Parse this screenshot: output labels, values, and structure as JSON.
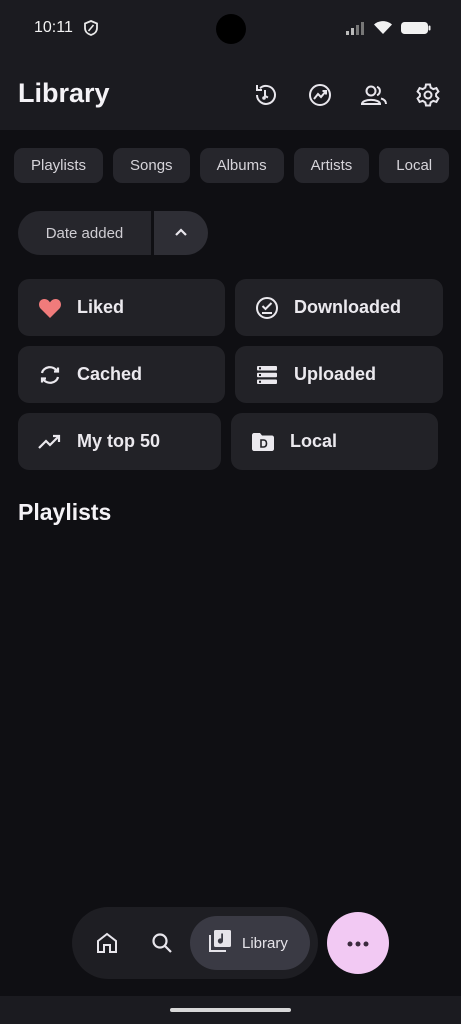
{
  "status_bar": {
    "time": "10:11"
  },
  "header": {
    "title": "Library"
  },
  "chips": [
    "Playlists",
    "Songs",
    "Albums",
    "Artists",
    "Local"
  ],
  "sort": {
    "label": "Date added",
    "direction": "ascending"
  },
  "tiles": [
    {
      "label": "Liked",
      "icon": "heart-icon"
    },
    {
      "label": "Downloaded",
      "icon": "download-done-icon"
    },
    {
      "label": "Cached",
      "icon": "sync-icon"
    },
    {
      "label": "Uploaded",
      "icon": "list-icon"
    },
    {
      "label": "My top 50",
      "icon": "trending-up-icon"
    },
    {
      "label": "Local",
      "icon": "folder-icon"
    }
  ],
  "section": {
    "title": "Playlists"
  },
  "nav": {
    "library_label": "Library"
  },
  "colors": {
    "accent": "#f2c9f3",
    "liked": "#f07b7b",
    "background": "#0f0f13"
  }
}
